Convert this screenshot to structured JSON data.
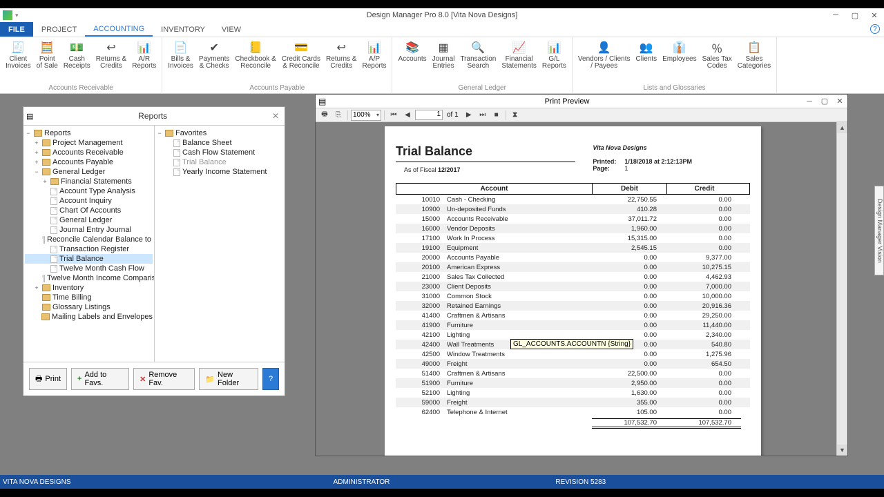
{
  "window": {
    "title": "Design Manager Pro 8.0 [Vita Nova Designs]",
    "company": "VITA NOVA DESIGNS",
    "user": "ADMINISTRATOR",
    "revision": "REVISION 5283",
    "sidetab": "Design Manager Vision"
  },
  "menu": {
    "file": "FILE",
    "project": "PROJECT",
    "accounting": "ACCOUNTING",
    "inventory": "INVENTORY",
    "view": "VIEW"
  },
  "ribbon": {
    "groups": {
      "ar": {
        "label": "Accounts Receivable",
        "btns": [
          {
            "id": "client-invoices",
            "label": "Client\nInvoices",
            "icon": "🧾"
          },
          {
            "id": "point-of-sale",
            "label": "Point\nof Sale",
            "icon": "🧮"
          },
          {
            "id": "cash-receipts",
            "label": "Cash\nReceipts",
            "icon": "💵"
          },
          {
            "id": "returns-credits-ar",
            "label": "Returns &\nCredits",
            "icon": "↩"
          },
          {
            "id": "ar-reports",
            "label": "A/R\nReports",
            "icon": "📊"
          }
        ]
      },
      "ap": {
        "label": "Accounts Payable",
        "btns": [
          {
            "id": "bills-invoices",
            "label": "Bills &\nInvoices",
            "icon": "📄"
          },
          {
            "id": "payments-checks",
            "label": "Payments\n& Checks",
            "icon": "✔"
          },
          {
            "id": "checkbook-reconcile",
            "label": "Checkbook &\nReconcile",
            "icon": "📒"
          },
          {
            "id": "credit-cards",
            "label": "Credit Cards\n& Reconcile",
            "icon": "💳"
          },
          {
            "id": "returns-credits-ap",
            "label": "Returns &\nCredits",
            "icon": "↩"
          },
          {
            "id": "ap-reports",
            "label": "A/P\nReports",
            "icon": "📊"
          }
        ]
      },
      "gl": {
        "label": "General Ledger",
        "btns": [
          {
            "id": "accounts",
            "label": "Accounts",
            "icon": "📚"
          },
          {
            "id": "journal-entries",
            "label": "Journal\nEntries",
            "icon": "▦"
          },
          {
            "id": "transaction-search",
            "label": "Transaction\nSearch",
            "icon": "🔍"
          },
          {
            "id": "financial-statements",
            "label": "Financial\nStatements",
            "icon": "📈"
          },
          {
            "id": "gl-reports",
            "label": "G/L\nReports",
            "icon": "📊"
          }
        ]
      },
      "lg": {
        "label": "Lists and Glossaries",
        "btns": [
          {
            "id": "vendors-payees",
            "label": "Vendors / Clients\n/ Payees",
            "icon": "👤"
          },
          {
            "id": "clients",
            "label": "Clients",
            "icon": "👥"
          },
          {
            "id": "employees",
            "label": "Employees",
            "icon": "👔"
          },
          {
            "id": "sales-tax",
            "label": "Sales Tax\nCodes",
            "icon": "％"
          },
          {
            "id": "sales-categories",
            "label": "Sales\nCategories",
            "icon": "📋"
          }
        ]
      }
    }
  },
  "reportsPanel": {
    "title": "Reports",
    "leftRoot": "Reports",
    "left": [
      {
        "label": "Project Management",
        "ind": 1,
        "exp": "+",
        "folder": true
      },
      {
        "label": "Accounts Receivable",
        "ind": 1,
        "exp": "+",
        "folder": true
      },
      {
        "label": "Accounts Payable",
        "ind": 1,
        "exp": "+",
        "folder": true
      },
      {
        "label": "General Ledger",
        "ind": 1,
        "exp": "−",
        "folder": true
      },
      {
        "label": "Financial Statements",
        "ind": 2,
        "exp": "+",
        "folder": true
      },
      {
        "label": "Account Type Analysis",
        "ind": 2,
        "doc": true
      },
      {
        "label": "Account Inquiry",
        "ind": 2,
        "doc": true
      },
      {
        "label": "Chart Of Accounts",
        "ind": 2,
        "doc": true
      },
      {
        "label": "General Ledger",
        "ind": 2,
        "doc": true
      },
      {
        "label": "Journal Entry Journal",
        "ind": 2,
        "doc": true
      },
      {
        "label": "Reconcile Calendar Balance to Fiscal",
        "ind": 2,
        "doc": true
      },
      {
        "label": "Transaction Register",
        "ind": 2,
        "doc": true
      },
      {
        "label": "Trial Balance",
        "ind": 2,
        "doc": true,
        "sel": true
      },
      {
        "label": "Twelve Month Cash Flow",
        "ind": 2,
        "doc": true
      },
      {
        "label": "Twelve Month Income Comparison",
        "ind": 2,
        "doc": true
      },
      {
        "label": "Inventory",
        "ind": 1,
        "exp": "+",
        "folder": true
      },
      {
        "label": "Time Billing",
        "ind": 1,
        "folder": true
      },
      {
        "label": "Glossary Listings",
        "ind": 1,
        "folder": true
      },
      {
        "label": "Mailing Labels and Envelopes",
        "ind": 1,
        "folder": true
      }
    ],
    "rightRoot": "Favorites",
    "right": [
      {
        "label": "Balance Sheet"
      },
      {
        "label": "Cash Flow Statement"
      },
      {
        "label": "Trial Balance",
        "dim": true
      },
      {
        "label": "Yearly Income Statement"
      }
    ],
    "buttons": {
      "print": "Print",
      "addfav": "Add to Favs.",
      "removefav": "Remove Fav.",
      "newfolder": "New Folder"
    }
  },
  "preview": {
    "title": "Print Preview",
    "zoom": "100%",
    "page": "1",
    "pageOf": "of 1",
    "tooltip": "GL_ACCOUNTS.ACCOUNTN {String}"
  },
  "report": {
    "title": "Trial Balance",
    "asOfLabel": "As of Fiscal",
    "asOf": "12/2017",
    "company": "Vita Nova Designs",
    "printedLabel": "Printed:",
    "printed": "1/18/2018 at 2:12:13PM",
    "pageLabel": "Page:",
    "pageNo": "1",
    "headers": {
      "account": "Account",
      "debit": "Debit",
      "credit": "Credit"
    },
    "rows": [
      {
        "n": "10010",
        "name": "Cash - Checking",
        "d": "22,750.55",
        "c": "0.00"
      },
      {
        "n": "10900",
        "name": "Un-deposited Funds",
        "d": "410.28",
        "c": "0.00"
      },
      {
        "n": "15000",
        "name": "Accounts Receivable",
        "d": "37,011.72",
        "c": "0.00"
      },
      {
        "n": "16000",
        "name": "Vendor Deposits",
        "d": "1,960.00",
        "c": "0.00"
      },
      {
        "n": "17100",
        "name": "Work In Process",
        "d": "15,315.00",
        "c": "0.00"
      },
      {
        "n": "19100",
        "name": "Equipment",
        "d": "2,545.15",
        "c": "0.00"
      },
      {
        "n": "20000",
        "name": "Accounts Payable",
        "d": "0.00",
        "c": "9,377.00"
      },
      {
        "n": "20100",
        "name": "American Express",
        "d": "0.00",
        "c": "10,275.15"
      },
      {
        "n": "21000",
        "name": "Sales Tax Collected",
        "d": "0.00",
        "c": "4,462.93"
      },
      {
        "n": "23000",
        "name": "Client Deposits",
        "d": "0.00",
        "c": "7,000.00"
      },
      {
        "n": "31000",
        "name": "Common Stock",
        "d": "0.00",
        "c": "10,000.00"
      },
      {
        "n": "32000",
        "name": "Retained Earnings",
        "d": "0.00",
        "c": "20,916.36"
      },
      {
        "n": "41400",
        "name": "Craftmen & Artisans",
        "d": "0.00",
        "c": "29,250.00"
      },
      {
        "n": "41900",
        "name": "Furniture",
        "d": "0.00",
        "c": "11,440.00"
      },
      {
        "n": "42100",
        "name": "Lighting",
        "d": "0.00",
        "c": "2,340.00"
      },
      {
        "n": "42400",
        "name": "Wall Treatments",
        "d": "0.00",
        "c": "540.80"
      },
      {
        "n": "42500",
        "name": "Window Treatments",
        "d": "0.00",
        "c": "1,275.96"
      },
      {
        "n": "49000",
        "name": "Freight",
        "d": "0.00",
        "c": "654.50"
      },
      {
        "n": "51400",
        "name": "Craftmen & Artisans",
        "d": "22,500.00",
        "c": "0.00"
      },
      {
        "n": "51900",
        "name": "Furniture",
        "d": "2,950.00",
        "c": "0.00"
      },
      {
        "n": "52100",
        "name": "Lighting",
        "d": "1,630.00",
        "c": "0.00"
      },
      {
        "n": "59000",
        "name": "Freight",
        "d": "355.00",
        "c": "0.00"
      },
      {
        "n": "62400",
        "name": "Telephone & Internet",
        "d": "105.00",
        "c": "0.00"
      }
    ],
    "totals": {
      "debit": "107,532.70",
      "credit": "107,532.70"
    }
  }
}
